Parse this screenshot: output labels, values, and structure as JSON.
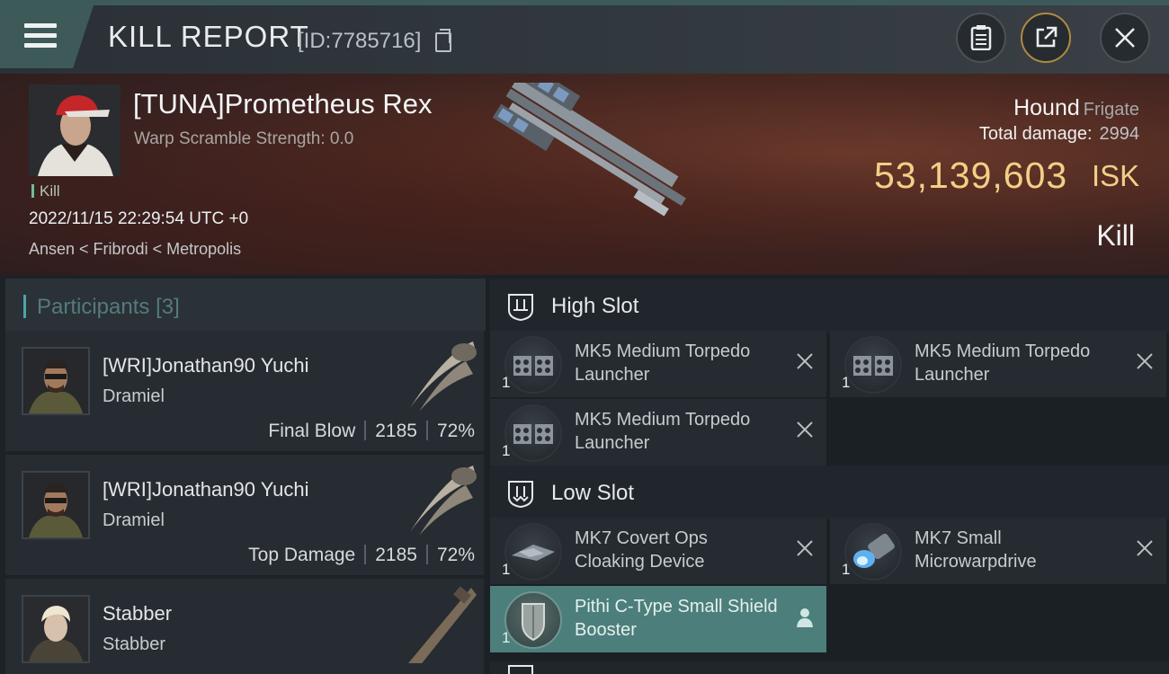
{
  "header": {
    "title": "KILL REPORT",
    "report_id": "[ID:7785716]"
  },
  "victim": {
    "name": "[TUNA]Prometheus Rex",
    "warp_scramble": "Warp Scramble Strength: 0.0",
    "kill_tag": "Kill",
    "datetime": "2022/11/15 22:29:54 UTC +0",
    "location": "Ansen < Fribrodi < Metropolis",
    "ship_name": "Hound",
    "ship_class": "Frigate",
    "damage_label": "Total damage:",
    "damage_value": "2994",
    "isk_value": "53,139,603",
    "isk_label": "ISK",
    "result": "Kill"
  },
  "participants": {
    "label": "Participants",
    "count": "[3]",
    "rows": [
      {
        "name": "[WRI]Jonathan90 Yuchi",
        "ship": "Dramiel",
        "role": "Final Blow",
        "damage": "2185",
        "percent": "72%"
      },
      {
        "name": "[WRI]Jonathan90 Yuchi",
        "ship": "Dramiel",
        "role": "Top Damage",
        "damage": "2185",
        "percent": "72%"
      },
      {
        "name": "Stabber",
        "ship": "Stabber"
      }
    ]
  },
  "slots": {
    "high": {
      "label": "High Slot",
      "modules": [
        {
          "name": "MK5 Medium Torpedo Launcher",
          "qty": "1"
        },
        {
          "name": "MK5 Medium Torpedo Launcher",
          "qty": "1"
        },
        {
          "name": "MK5 Medium Torpedo Launcher",
          "qty": "1"
        }
      ]
    },
    "low": {
      "label": "Low Slot",
      "modules": [
        {
          "name": "MK7 Covert Ops Cloaking Device",
          "qty": "1"
        },
        {
          "name": "MK7 Small Microwarpdrive",
          "qty": "1"
        },
        {
          "name": "Pithi C-Type Small Shield Booster",
          "qty": "1"
        }
      ]
    }
  },
  "colors": {
    "isk_gold": "#f2cf86",
    "accent_teal": "#4fa3a8",
    "active_module": "#4c7f7b"
  }
}
